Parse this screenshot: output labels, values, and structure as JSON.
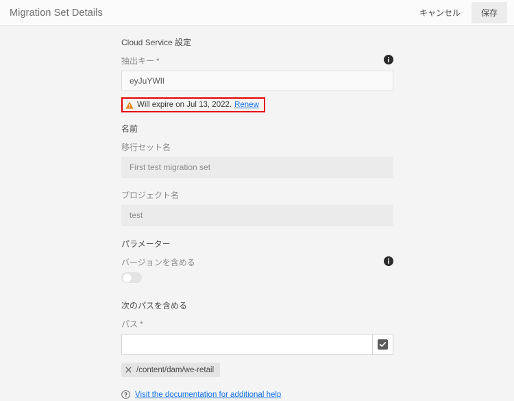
{
  "header": {
    "title": "Migration Set Details",
    "cancel_label": "キャンセル",
    "save_label": "保存"
  },
  "form": {
    "cloud_service_section": "Cloud Service 設定",
    "extraction_key": {
      "label": "抽出キー",
      "required_mark": "*",
      "value": "eyJuYWIl",
      "info_icon": "info-icon"
    },
    "warning": {
      "icon": "warning-triangle-icon",
      "text": "Will expire on Jul 13, 2022.",
      "link_label": "Renew",
      "highlight_color": "#e60000",
      "icon_color": "#e68619",
      "link_color": "#1473e6"
    },
    "name_section": "名前",
    "migration_set_name": {
      "label": "移行セット名",
      "value": "First test migration set"
    },
    "project_name": {
      "label": "プロジェクト名",
      "value": "test"
    },
    "parameters_section": "パラメーター",
    "include_versions": {
      "label": "バージョンを含める",
      "state": "off",
      "info_icon": "info-icon"
    },
    "include_paths_section": "次のパスを含める",
    "path": {
      "label": "パス",
      "required_mark": "*",
      "value": "",
      "browse_icon": "checkbox-checked-icon"
    },
    "path_chips": [
      {
        "label": "/content/dam/we-retail",
        "remove_icon": "close-icon"
      }
    ],
    "help": {
      "icon": "question-circle-icon",
      "link_label": "Visit the documentation for additional help"
    }
  }
}
